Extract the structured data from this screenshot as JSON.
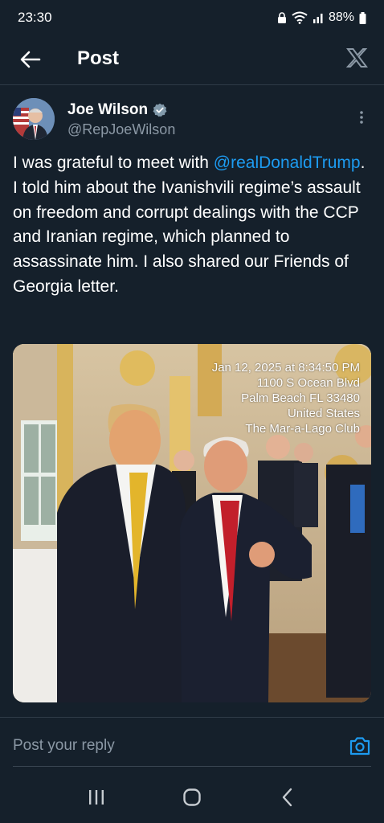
{
  "status_bar": {
    "time": "23:30",
    "battery": "88%"
  },
  "header": {
    "title": "Post",
    "back_icon": "arrow-left-icon",
    "logo_icon": "x-logo-icon"
  },
  "post": {
    "author_name": "Joe Wilson",
    "author_handle": "@RepJoeWilson",
    "verified_icon": "verified-badge-icon",
    "text_before": "I was grateful to meet with ",
    "mention": "@realDonaldTrump",
    "text_after": ". I told him about the Ivanishvili regime’s assault on freedom and corrupt dealings with the CCP and Iranian regime, which planned to assassinate him. I also shared our Friends of Georgia letter.",
    "photo_overlay": {
      "line1": "Jan 12, 2025 at 8:34:50 PM",
      "line2": "1100 S Ocean Blvd",
      "line3": "Palm Beach FL 33480",
      "line4": "United States",
      "line5": "The Mar-a-Lago Club"
    }
  },
  "reply": {
    "placeholder": "Post your reply",
    "camera_icon": "camera-icon"
  },
  "nav": {
    "recents_icon": "recents-icon",
    "home_icon": "home-icon",
    "back_icon": "nav-back-icon"
  },
  "colors": {
    "background": "#15202b",
    "accent": "#1d9bf0",
    "secondary_text": "#8b98a5"
  }
}
